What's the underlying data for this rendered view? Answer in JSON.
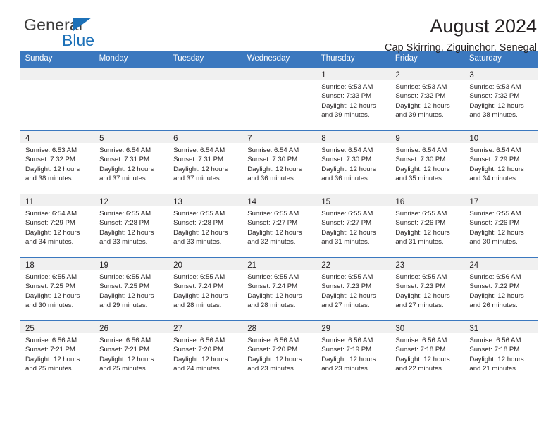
{
  "logo": {
    "word_top": "General",
    "word_bottom": "Blue",
    "triangle_icon": "triangle-icon",
    "accent_color": "#1d71b8"
  },
  "header": {
    "title": "August 2024",
    "subtitle": "Cap Skirring, Ziguinchor, Senegal"
  },
  "calendar": {
    "header_color": "#3b78bf",
    "weekday_headers": [
      "Sunday",
      "Monday",
      "Tuesday",
      "Wednesday",
      "Thursday",
      "Friday",
      "Saturday"
    ],
    "weeks": [
      [
        {
          "day": "",
          "sunrise": "",
          "sunset": "",
          "daylight_line1": "",
          "daylight_line2": ""
        },
        {
          "day": "",
          "sunrise": "",
          "sunset": "",
          "daylight_line1": "",
          "daylight_line2": ""
        },
        {
          "day": "",
          "sunrise": "",
          "sunset": "",
          "daylight_line1": "",
          "daylight_line2": ""
        },
        {
          "day": "",
          "sunrise": "",
          "sunset": "",
          "daylight_line1": "",
          "daylight_line2": ""
        },
        {
          "day": "1",
          "sunrise": "Sunrise: 6:53 AM",
          "sunset": "Sunset: 7:33 PM",
          "daylight_line1": "Daylight: 12 hours",
          "daylight_line2": "and 39 minutes."
        },
        {
          "day": "2",
          "sunrise": "Sunrise: 6:53 AM",
          "sunset": "Sunset: 7:32 PM",
          "daylight_line1": "Daylight: 12 hours",
          "daylight_line2": "and 39 minutes."
        },
        {
          "day": "3",
          "sunrise": "Sunrise: 6:53 AM",
          "sunset": "Sunset: 7:32 PM",
          "daylight_line1": "Daylight: 12 hours",
          "daylight_line2": "and 38 minutes."
        }
      ],
      [
        {
          "day": "4",
          "sunrise": "Sunrise: 6:53 AM",
          "sunset": "Sunset: 7:32 PM",
          "daylight_line1": "Daylight: 12 hours",
          "daylight_line2": "and 38 minutes."
        },
        {
          "day": "5",
          "sunrise": "Sunrise: 6:54 AM",
          "sunset": "Sunset: 7:31 PM",
          "daylight_line1": "Daylight: 12 hours",
          "daylight_line2": "and 37 minutes."
        },
        {
          "day": "6",
          "sunrise": "Sunrise: 6:54 AM",
          "sunset": "Sunset: 7:31 PM",
          "daylight_line1": "Daylight: 12 hours",
          "daylight_line2": "and 37 minutes."
        },
        {
          "day": "7",
          "sunrise": "Sunrise: 6:54 AM",
          "sunset": "Sunset: 7:30 PM",
          "daylight_line1": "Daylight: 12 hours",
          "daylight_line2": "and 36 minutes."
        },
        {
          "day": "8",
          "sunrise": "Sunrise: 6:54 AM",
          "sunset": "Sunset: 7:30 PM",
          "daylight_line1": "Daylight: 12 hours",
          "daylight_line2": "and 36 minutes."
        },
        {
          "day": "9",
          "sunrise": "Sunrise: 6:54 AM",
          "sunset": "Sunset: 7:30 PM",
          "daylight_line1": "Daylight: 12 hours",
          "daylight_line2": "and 35 minutes."
        },
        {
          "day": "10",
          "sunrise": "Sunrise: 6:54 AM",
          "sunset": "Sunset: 7:29 PM",
          "daylight_line1": "Daylight: 12 hours",
          "daylight_line2": "and 34 minutes."
        }
      ],
      [
        {
          "day": "11",
          "sunrise": "Sunrise: 6:54 AM",
          "sunset": "Sunset: 7:29 PM",
          "daylight_line1": "Daylight: 12 hours",
          "daylight_line2": "and 34 minutes."
        },
        {
          "day": "12",
          "sunrise": "Sunrise: 6:55 AM",
          "sunset": "Sunset: 7:28 PM",
          "daylight_line1": "Daylight: 12 hours",
          "daylight_line2": "and 33 minutes."
        },
        {
          "day": "13",
          "sunrise": "Sunrise: 6:55 AM",
          "sunset": "Sunset: 7:28 PM",
          "daylight_line1": "Daylight: 12 hours",
          "daylight_line2": "and 33 minutes."
        },
        {
          "day": "14",
          "sunrise": "Sunrise: 6:55 AM",
          "sunset": "Sunset: 7:27 PM",
          "daylight_line1": "Daylight: 12 hours",
          "daylight_line2": "and 32 minutes."
        },
        {
          "day": "15",
          "sunrise": "Sunrise: 6:55 AM",
          "sunset": "Sunset: 7:27 PM",
          "daylight_line1": "Daylight: 12 hours",
          "daylight_line2": "and 31 minutes."
        },
        {
          "day": "16",
          "sunrise": "Sunrise: 6:55 AM",
          "sunset": "Sunset: 7:26 PM",
          "daylight_line1": "Daylight: 12 hours",
          "daylight_line2": "and 31 minutes."
        },
        {
          "day": "17",
          "sunrise": "Sunrise: 6:55 AM",
          "sunset": "Sunset: 7:26 PM",
          "daylight_line1": "Daylight: 12 hours",
          "daylight_line2": "and 30 minutes."
        }
      ],
      [
        {
          "day": "18",
          "sunrise": "Sunrise: 6:55 AM",
          "sunset": "Sunset: 7:25 PM",
          "daylight_line1": "Daylight: 12 hours",
          "daylight_line2": "and 30 minutes."
        },
        {
          "day": "19",
          "sunrise": "Sunrise: 6:55 AM",
          "sunset": "Sunset: 7:25 PM",
          "daylight_line1": "Daylight: 12 hours",
          "daylight_line2": "and 29 minutes."
        },
        {
          "day": "20",
          "sunrise": "Sunrise: 6:55 AM",
          "sunset": "Sunset: 7:24 PM",
          "daylight_line1": "Daylight: 12 hours",
          "daylight_line2": "and 28 minutes."
        },
        {
          "day": "21",
          "sunrise": "Sunrise: 6:55 AM",
          "sunset": "Sunset: 7:24 PM",
          "daylight_line1": "Daylight: 12 hours",
          "daylight_line2": "and 28 minutes."
        },
        {
          "day": "22",
          "sunrise": "Sunrise: 6:55 AM",
          "sunset": "Sunset: 7:23 PM",
          "daylight_line1": "Daylight: 12 hours",
          "daylight_line2": "and 27 minutes."
        },
        {
          "day": "23",
          "sunrise": "Sunrise: 6:55 AM",
          "sunset": "Sunset: 7:23 PM",
          "daylight_line1": "Daylight: 12 hours",
          "daylight_line2": "and 27 minutes."
        },
        {
          "day": "24",
          "sunrise": "Sunrise: 6:56 AM",
          "sunset": "Sunset: 7:22 PM",
          "daylight_line1": "Daylight: 12 hours",
          "daylight_line2": "and 26 minutes."
        }
      ],
      [
        {
          "day": "25",
          "sunrise": "Sunrise: 6:56 AM",
          "sunset": "Sunset: 7:21 PM",
          "daylight_line1": "Daylight: 12 hours",
          "daylight_line2": "and 25 minutes."
        },
        {
          "day": "26",
          "sunrise": "Sunrise: 6:56 AM",
          "sunset": "Sunset: 7:21 PM",
          "daylight_line1": "Daylight: 12 hours",
          "daylight_line2": "and 25 minutes."
        },
        {
          "day": "27",
          "sunrise": "Sunrise: 6:56 AM",
          "sunset": "Sunset: 7:20 PM",
          "daylight_line1": "Daylight: 12 hours",
          "daylight_line2": "and 24 minutes."
        },
        {
          "day": "28",
          "sunrise": "Sunrise: 6:56 AM",
          "sunset": "Sunset: 7:20 PM",
          "daylight_line1": "Daylight: 12 hours",
          "daylight_line2": "and 23 minutes."
        },
        {
          "day": "29",
          "sunrise": "Sunrise: 6:56 AM",
          "sunset": "Sunset: 7:19 PM",
          "daylight_line1": "Daylight: 12 hours",
          "daylight_line2": "and 23 minutes."
        },
        {
          "day": "30",
          "sunrise": "Sunrise: 6:56 AM",
          "sunset": "Sunset: 7:18 PM",
          "daylight_line1": "Daylight: 12 hours",
          "daylight_line2": "and 22 minutes."
        },
        {
          "day": "31",
          "sunrise": "Sunrise: 6:56 AM",
          "sunset": "Sunset: 7:18 PM",
          "daylight_line1": "Daylight: 12 hours",
          "daylight_line2": "and 21 minutes."
        }
      ]
    ]
  }
}
